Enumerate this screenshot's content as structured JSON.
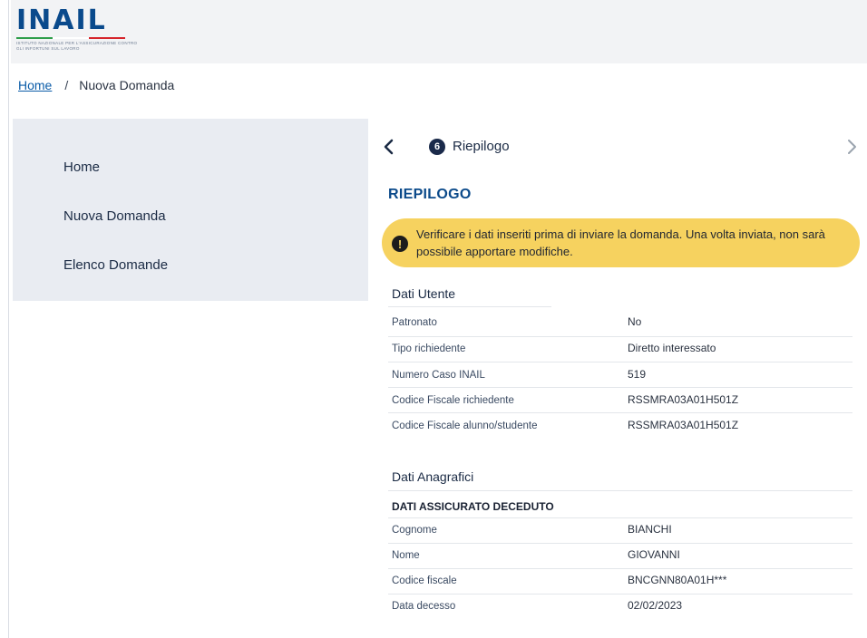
{
  "brand": {
    "logo_text": "INAIL",
    "logo_subtitle": "ISTITUTO NAZIONALE PER L'ASSICURAZIONE CONTRO GLI INFORTUNI SUL LAVORO",
    "flag_colors": [
      "#2e9e4a",
      "#ffffff",
      "#d6242b"
    ]
  },
  "breadcrumb": {
    "home": "Home",
    "separator": "/",
    "current": "Nuova Domanda"
  },
  "sidebar": {
    "items": [
      {
        "label": "Home"
      },
      {
        "label": "Nuova Domanda"
      },
      {
        "label": "Elenco Domande"
      }
    ]
  },
  "stepper": {
    "step_number": "6",
    "step_label": "Riepilogo",
    "prev_icon": "chevron-left-icon",
    "next_icon": "chevron-right-icon"
  },
  "section_title": "RIEPILOGO",
  "alert": {
    "icon": "exclamation-icon",
    "text": "Verificare i dati inseriti prima di inviare la domanda. Una volta inviata, non sarà possibile apportare modifiche."
  },
  "dati_utente": {
    "title": "Dati Utente",
    "rows": [
      {
        "label": "Patronato",
        "value": "No"
      },
      {
        "label": "Tipo richiedente",
        "value": "Diretto interessato"
      },
      {
        "label": "Numero Caso INAIL",
        "value": "519"
      },
      {
        "label": "Codice Fiscale richiedente",
        "value": "RSSMRA03A01H501Z"
      },
      {
        "label": "Codice Fiscale alunno/studente",
        "value": "RSSMRA03A01H501Z"
      }
    ]
  },
  "dati_anagrafici": {
    "title": "Dati Anagrafici",
    "subtitle": "DATI ASSICURATO DECEDUTO",
    "rows": [
      {
        "label": "Cognome",
        "value": "BIANCHI"
      },
      {
        "label": "Nome",
        "value": "GIOVANNI"
      },
      {
        "label": "Codice fiscale",
        "value": "BNCGNN80A01H***"
      },
      {
        "label": "Data decesso",
        "value": "02/02/2023"
      }
    ]
  },
  "colors": {
    "primary": "#0b4a8a",
    "link": "#0b5ca8",
    "alert_bg": "#f6d25f",
    "sidebar_bg": "#e9ecf2",
    "header_bg": "#f2f3f5"
  }
}
